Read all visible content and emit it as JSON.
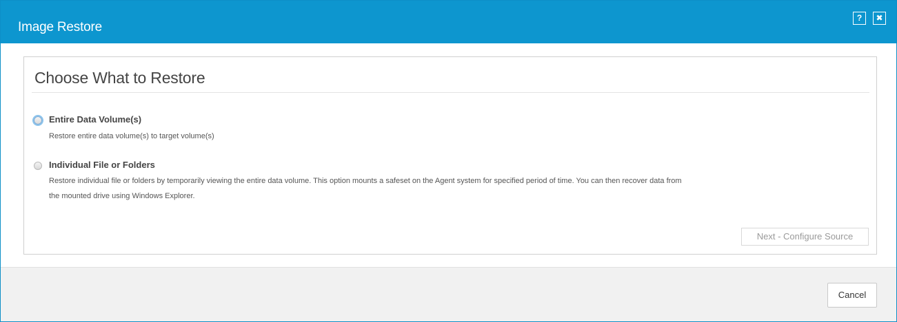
{
  "window": {
    "title": "Image Restore",
    "help_label": "?",
    "close_label": "✖"
  },
  "panel": {
    "title": "Choose What to Restore",
    "options": [
      {
        "label": "Entire Data Volume(s)",
        "description": "Restore entire data volume(s) to target volume(s)",
        "focused": true,
        "selected": false
      },
      {
        "label": "Individual File or Folders",
        "description_line1": "Restore individual file or folders by temporarily viewing the entire data volume. This option mounts a safeset on the Agent system for specified period of time. You can then recover data from",
        "description_line2": "the mounted drive using Windows Explorer.",
        "focused": false,
        "selected": false
      }
    ],
    "next_button_label": "Next - Configure Source"
  },
  "footer": {
    "cancel_label": "Cancel"
  },
  "colors": {
    "titlebar": "#0d96cf",
    "focus_ring": "#8cc4ec",
    "footer_bg": "#f1f1f1"
  }
}
